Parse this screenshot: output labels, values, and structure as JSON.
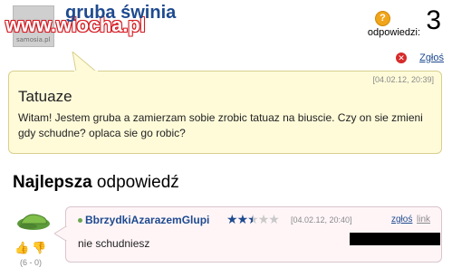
{
  "header": {
    "watermark": "www.wiocha.pl",
    "avatar_label": "samosia.pl",
    "username": "gruba świnia",
    "answers_label": "odpowiedzi:",
    "answers_count": "3",
    "report_label": "Zgłoś"
  },
  "question": {
    "date": "[04.02.12, 20:39]",
    "title": "Tatuaze",
    "body": "Witam! Jestem gruba a zamierzam sobie zrobic tatuaz na biuscie. Czy on sie zmieni gdy schudne? oplaca sie go robic?"
  },
  "best_answer": {
    "heading_bold": "Najlepsza",
    "heading_rest": " odpowiedź",
    "user": "BbrzydkiAzarazemGlupi",
    "rating": 2.5,
    "rating_max": 5,
    "date": "[04.02.12, 20:40]",
    "report_label": "zgłoś",
    "link_label": "link",
    "text": "nie schudniesz",
    "votes": "(6 - 0)"
  },
  "colors": {
    "link_blue": "#1e4a8f",
    "question_bg": "#fffbd9",
    "answer_bg": "#fff5f7",
    "watermark_red": "#d71920"
  },
  "icons": {
    "question": "question-mark-icon",
    "report": "report-x-icon",
    "vote_up": "thumb-up-icon",
    "vote_down": "thumb-down-icon"
  }
}
